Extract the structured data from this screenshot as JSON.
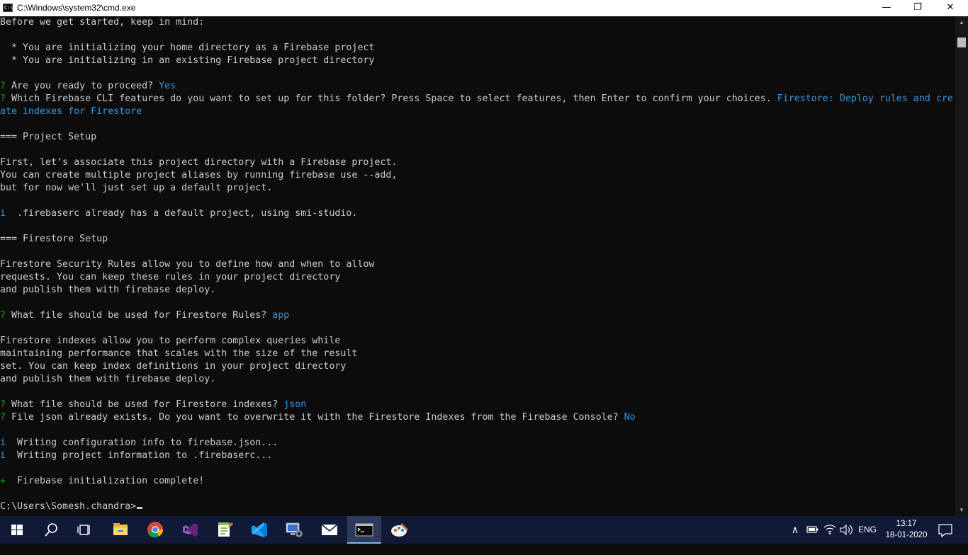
{
  "window": {
    "title": "C:\\Windows\\system32\\cmd.exe",
    "icon_text": "C:\\",
    "minimize": "—",
    "maximize": "❐",
    "close": "✕"
  },
  "console": {
    "lines": [
      {
        "segments": [
          {
            "text": "Before we get started, keep in mind:"
          }
        ]
      },
      {
        "segments": []
      },
      {
        "segments": [
          {
            "text": "  * You are initializing your home directory as a Firebase project"
          }
        ]
      },
      {
        "segments": [
          {
            "text": "  * You are initializing in an existing Firebase project directory"
          }
        ]
      },
      {
        "segments": []
      },
      {
        "segments": [
          {
            "text": "?",
            "style": "q"
          },
          {
            "text": " Are you ready to proceed? "
          },
          {
            "text": "Yes",
            "style": "ans"
          }
        ]
      },
      {
        "segments": [
          {
            "text": "?",
            "style": "q"
          },
          {
            "text": " Which Firebase CLI features do you want to set up for this folder? Press Space to select features, then Enter to confirm your choices. "
          },
          {
            "text": "Firestore: Deploy rules and cre",
            "style": "ans"
          }
        ]
      },
      {
        "segments": [
          {
            "text": "ate indexes for Firestore",
            "style": "ans"
          }
        ]
      },
      {
        "segments": []
      },
      {
        "segments": [
          {
            "text": "=== Project Setup"
          }
        ]
      },
      {
        "segments": []
      },
      {
        "segments": [
          {
            "text": "First, let's associate this project directory with a Firebase project."
          }
        ]
      },
      {
        "segments": [
          {
            "text": "You can create multiple project aliases by running firebase use --add,"
          }
        ]
      },
      {
        "segments": [
          {
            "text": "but for now we'll just set up a default project."
          }
        ]
      },
      {
        "segments": []
      },
      {
        "segments": [
          {
            "text": "i",
            "style": "ans"
          },
          {
            "text": "  .firebaserc already has a default project, using smi-studio."
          }
        ]
      },
      {
        "segments": []
      },
      {
        "segments": [
          {
            "text": "=== Firestore Setup"
          }
        ]
      },
      {
        "segments": []
      },
      {
        "segments": [
          {
            "text": "Firestore Security Rules allow you to define how and when to allow"
          }
        ]
      },
      {
        "segments": [
          {
            "text": "requests. You can keep these rules in your project directory"
          }
        ]
      },
      {
        "segments": [
          {
            "text": "and publish them with firebase deploy."
          }
        ]
      },
      {
        "segments": []
      },
      {
        "segments": [
          {
            "text": "?",
            "style": "q"
          },
          {
            "text": " What file should be used for Firestore Rules? "
          },
          {
            "text": "app",
            "style": "ans"
          }
        ]
      },
      {
        "segments": []
      },
      {
        "segments": [
          {
            "text": "Firestore indexes allow you to perform complex queries while"
          }
        ]
      },
      {
        "segments": [
          {
            "text": "maintaining performance that scales with the size of the result"
          }
        ]
      },
      {
        "segments": [
          {
            "text": "set. You can keep index definitions in your project directory"
          }
        ]
      },
      {
        "segments": [
          {
            "text": "and publish them with firebase deploy."
          }
        ]
      },
      {
        "segments": []
      },
      {
        "segments": [
          {
            "text": "?",
            "style": "q"
          },
          {
            "text": " What file should be used for Firestore indexes? "
          },
          {
            "text": "json",
            "style": "ans"
          }
        ]
      },
      {
        "segments": [
          {
            "text": "?",
            "style": "q"
          },
          {
            "text": " File json already exists. Do you want to overwrite it with the Firestore Indexes from the Firebase Console? "
          },
          {
            "text": "No",
            "style": "ans"
          }
        ]
      },
      {
        "segments": []
      },
      {
        "segments": [
          {
            "text": "i",
            "style": "ans"
          },
          {
            "text": "  Writing configuration info to firebase.json..."
          }
        ]
      },
      {
        "segments": [
          {
            "text": "i",
            "style": "ans"
          },
          {
            "text": "  Writing project information to .firebaserc..."
          }
        ]
      },
      {
        "segments": []
      },
      {
        "segments": [
          {
            "text": "+",
            "style": "q"
          },
          {
            "text": "  Firebase initialization complete!"
          }
        ]
      },
      {
        "segments": []
      }
    ],
    "prompt": "C:\\Users\\Somesh.chandra>"
  },
  "scrollbar": {
    "up": "▲",
    "down": "▼"
  },
  "taskbar": {
    "pinned": [
      {
        "name": "start-icon"
      },
      {
        "name": "search-icon"
      },
      {
        "name": "task-view-icon"
      },
      {
        "name": "file-explorer-icon"
      },
      {
        "name": "chrome-icon"
      },
      {
        "name": "visual-studio-icon"
      },
      {
        "name": "notepad-plus-plus-icon"
      },
      {
        "name": "vscode-icon"
      },
      {
        "name": "network-config-icon"
      },
      {
        "name": "mail-icon"
      },
      {
        "name": "cmd-icon"
      },
      {
        "name": "paint-icon"
      }
    ],
    "tray": {
      "chevron": "∧",
      "language": "ENG",
      "time": "13:17",
      "date": "18-01-2020"
    },
    "colors": {
      "background": "#101935",
      "active": "#2e3a5b",
      "accent": "#76b9ed"
    }
  }
}
